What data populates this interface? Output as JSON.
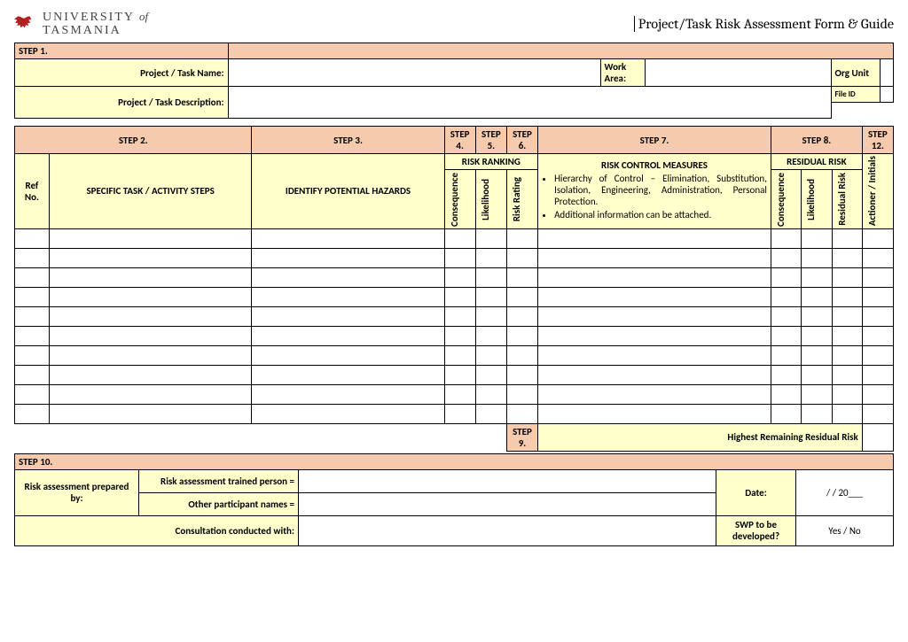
{
  "logo": {
    "line1": "UNIVERSITY",
    "of": "of",
    "line2": "TASMANIA"
  },
  "title": "Project/Task Risk Assessment Form & Guide",
  "step1": {
    "hdr": "STEP 1.",
    "name_lbl": "Project / Task Name:",
    "work_area_lbl": "Work Area:",
    "org_unit_lbl": "Org Unit",
    "desc_lbl": "Project / Task Description:",
    "file_id_lbl": "File ID"
  },
  "cols": {
    "step2": "STEP 2.",
    "step3": "STEP 3.",
    "step4": "STEP 4.",
    "step5": "STEP 5.",
    "step6": "STEP 6.",
    "step7": "STEP 7.",
    "step8": "STEP 8.",
    "step12": "STEP 12.",
    "risk_ranking": "RISK RANKING",
    "residual_risk": "RESIDUAL RISK",
    "ref": "Ref No.",
    "task": "SPECIFIC TASK / ACTIVITY STEPS",
    "hazards": "IDENTIFY POTENTIAL HAZARDS",
    "conseq": "Consequence",
    "likeli": "Likelihood",
    "rating": "Risk Rating",
    "resid": "Residual Risk",
    "actioner": "Actioner / Initials",
    "controls_hdr": "RISK CONTROL MEASURES",
    "controls_b1": "Hierarchy of Control – Elimination, Substitution, Isolation, Engineering, Administration, Personal Protection.",
    "controls_b2": "Additional information can be attached."
  },
  "step9": {
    "hdr": "STEP 9.",
    "label": "Highest Remaining Residual Risk"
  },
  "step10": {
    "hdr": "STEP 10.",
    "prep_by": "Risk assessment prepared by:",
    "trained": "Risk assessment trained person =",
    "others": "Other participant names =",
    "date": "Date:",
    "date_val": "/      / 20___",
    "consult": "Consultation conducted with:",
    "swp": "SWP to be developed?",
    "swp_val": "Yes    /    No"
  }
}
